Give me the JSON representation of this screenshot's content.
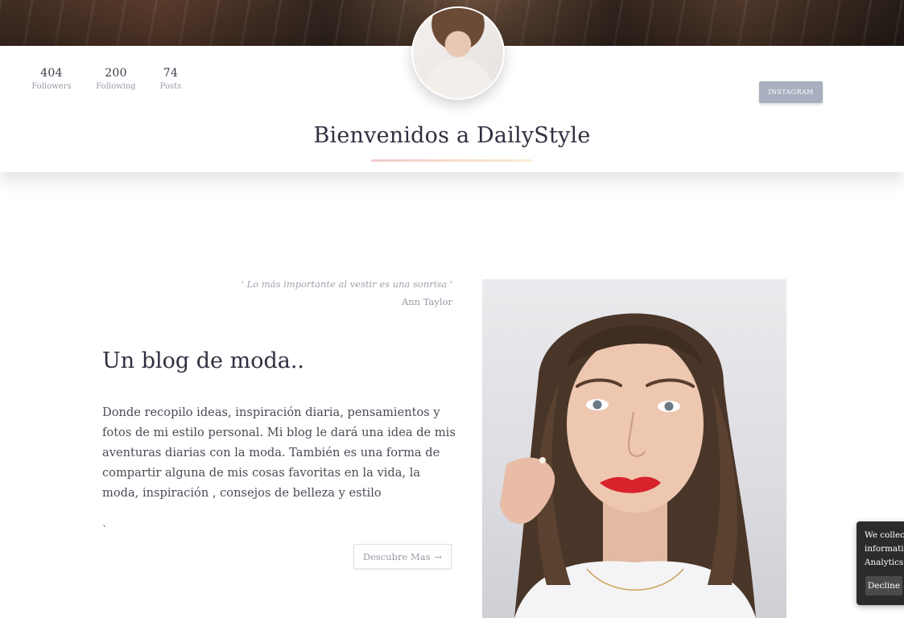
{
  "profile": {
    "stats": [
      {
        "value": "404",
        "label": "Followers"
      },
      {
        "value": "200",
        "label": "Following"
      },
      {
        "value": "74",
        "label": "Posts"
      }
    ],
    "instagram_label": "INSTAGRAM",
    "site_title": "Bienvenidos a DailyStyle"
  },
  "intro": {
    "quote": "' Lo más importante al vestir es una sonrisa '",
    "quote_author": "Ann Taylor",
    "heading": "Un blog de moda..",
    "body": "Donde recopilo ideas, inspiración diaria, pensamientos y fotos de mi estilo personal. Mi blog le dará una idea de mis aventuras diarias con la moda. También es una forma de compartir alguna de mis cosas favoritas en la vida, la moda, inspiración , consejos de belleza y estilo",
    "stray_mark": "`",
    "cta_label": "Descubre Mas",
    "cta_icon": "arrow-right-icon"
  },
  "cookie_notice": {
    "lines": [
      "We collect",
      "informatio",
      "Analytics."
    ],
    "decline_label": "Decline"
  },
  "colors": {
    "title": "#2f3040",
    "muted": "#9a9aa8",
    "instagram_button": "#a8b0c0",
    "cookie_bg": "#2b2b2b"
  }
}
